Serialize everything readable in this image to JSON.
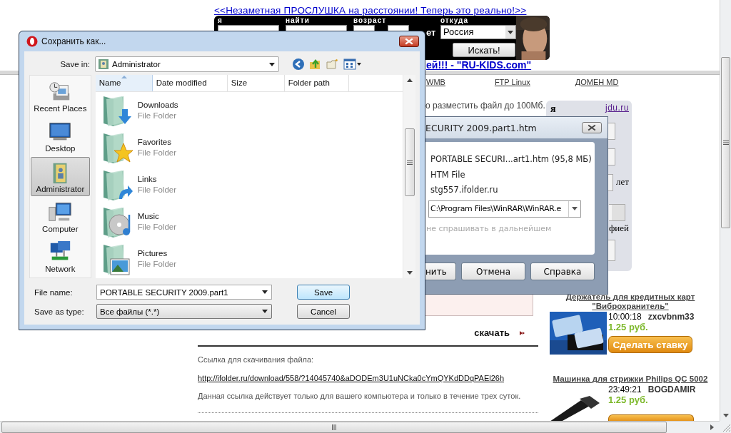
{
  "browser_page": {
    "ad_link": "<<Незаметная ПРОСЛУШКА на расстоянии! Теперь это реально!>>",
    "search_banner": {
      "labels": [
        "я",
        "найти",
        "возраст",
        "откуда"
      ],
      "cut_text": "ет",
      "country": "Россия",
      "search_button": "Искать!"
    },
    "promo_link": "ей!!! - \"RU-KIDS.com\"",
    "nav_links": [
      "WMB",
      "FTP Linux",
      "ДОМЕН MD"
    ],
    "upload_note": "о разместить файл до 100Мб.",
    "side_form": {
      "link": "jdu.ru",
      "label": "я",
      "age_unit": "лет",
      "photo_text": "фией"
    },
    "download_heading": "скачать",
    "link_caption": "Ссылка для скачивания файла:",
    "download_url": "http://ifolder.ru/download/558/?14045740&aDODEm3U1uNCka0cYmQYKdDDqPAEl26h",
    "link_note": "Данная ссылка действует только для вашего компьютера и только в течение трех суток.",
    "auctions": [
      {
        "title": "Держатель для кредитных карт \"Виброхранитель\"",
        "time": "10:00:18",
        "user": "zxcvbnm33",
        "price": "1.25 руб.",
        "bid_button": "Сделать ставку"
      },
      {
        "title": "Машинка для стрижки Philips QC 5002",
        "time": "23:49:21",
        "user": "BOGDAMIR",
        "price": "1.25 руб."
      }
    ]
  },
  "save_dialog": {
    "title": "Сохранить как...",
    "save_in_label": "Save in:",
    "save_in_value": "Administrator",
    "places": [
      {
        "kind": "recent",
        "label": "Recent Places",
        "selected": false
      },
      {
        "kind": "desktop",
        "label": "Desktop",
        "selected": false
      },
      {
        "kind": "user",
        "label": "Administrator",
        "selected": true
      },
      {
        "kind": "computer",
        "label": "Computer",
        "selected": false
      },
      {
        "kind": "network",
        "label": "Network",
        "selected": false
      }
    ],
    "columns": [
      {
        "label": "Name",
        "sorted": true
      },
      {
        "label": "Date modified",
        "sorted": false
      },
      {
        "label": "Size",
        "sorted": false
      },
      {
        "label": "Folder path",
        "sorted": false
      }
    ],
    "files": [
      {
        "kind": "downloads",
        "name": "Downloads",
        "type": "File Folder"
      },
      {
        "kind": "favorites",
        "name": "Favorites",
        "type": "File Folder"
      },
      {
        "kind": "links",
        "name": "Links",
        "type": "File Folder"
      },
      {
        "kind": "music",
        "name": "Music",
        "type": "File Folder"
      },
      {
        "kind": "pictures",
        "name": "Pictures",
        "type": "File Folder"
      }
    ],
    "file_name_label": "File name:",
    "file_name": "PORTABLE SECURITY 2009.part1",
    "type_label": "Save as type:",
    "type_value": "Все файлы (*.*)",
    "buttons": [
      {
        "label": "Save",
        "default": true
      },
      {
        "label": "Cancel",
        "default": false
      }
    ]
  },
  "rar_dialog": {
    "title": "ECURITY 2009.part1.htm",
    "file_info": "PORTABLE SECURI...art1.htm (95,8 МБ)",
    "file_type": "HTM File",
    "host": "stg557.ifolder.ru",
    "app_path": "C:\\Program Files\\WinRAR\\WinRAR.e",
    "remember_label": "не спрашивать в дальнейшем",
    "remember_disabled": true,
    "buttons": [
      "нить",
      "Отмена",
      "Справка"
    ]
  }
}
